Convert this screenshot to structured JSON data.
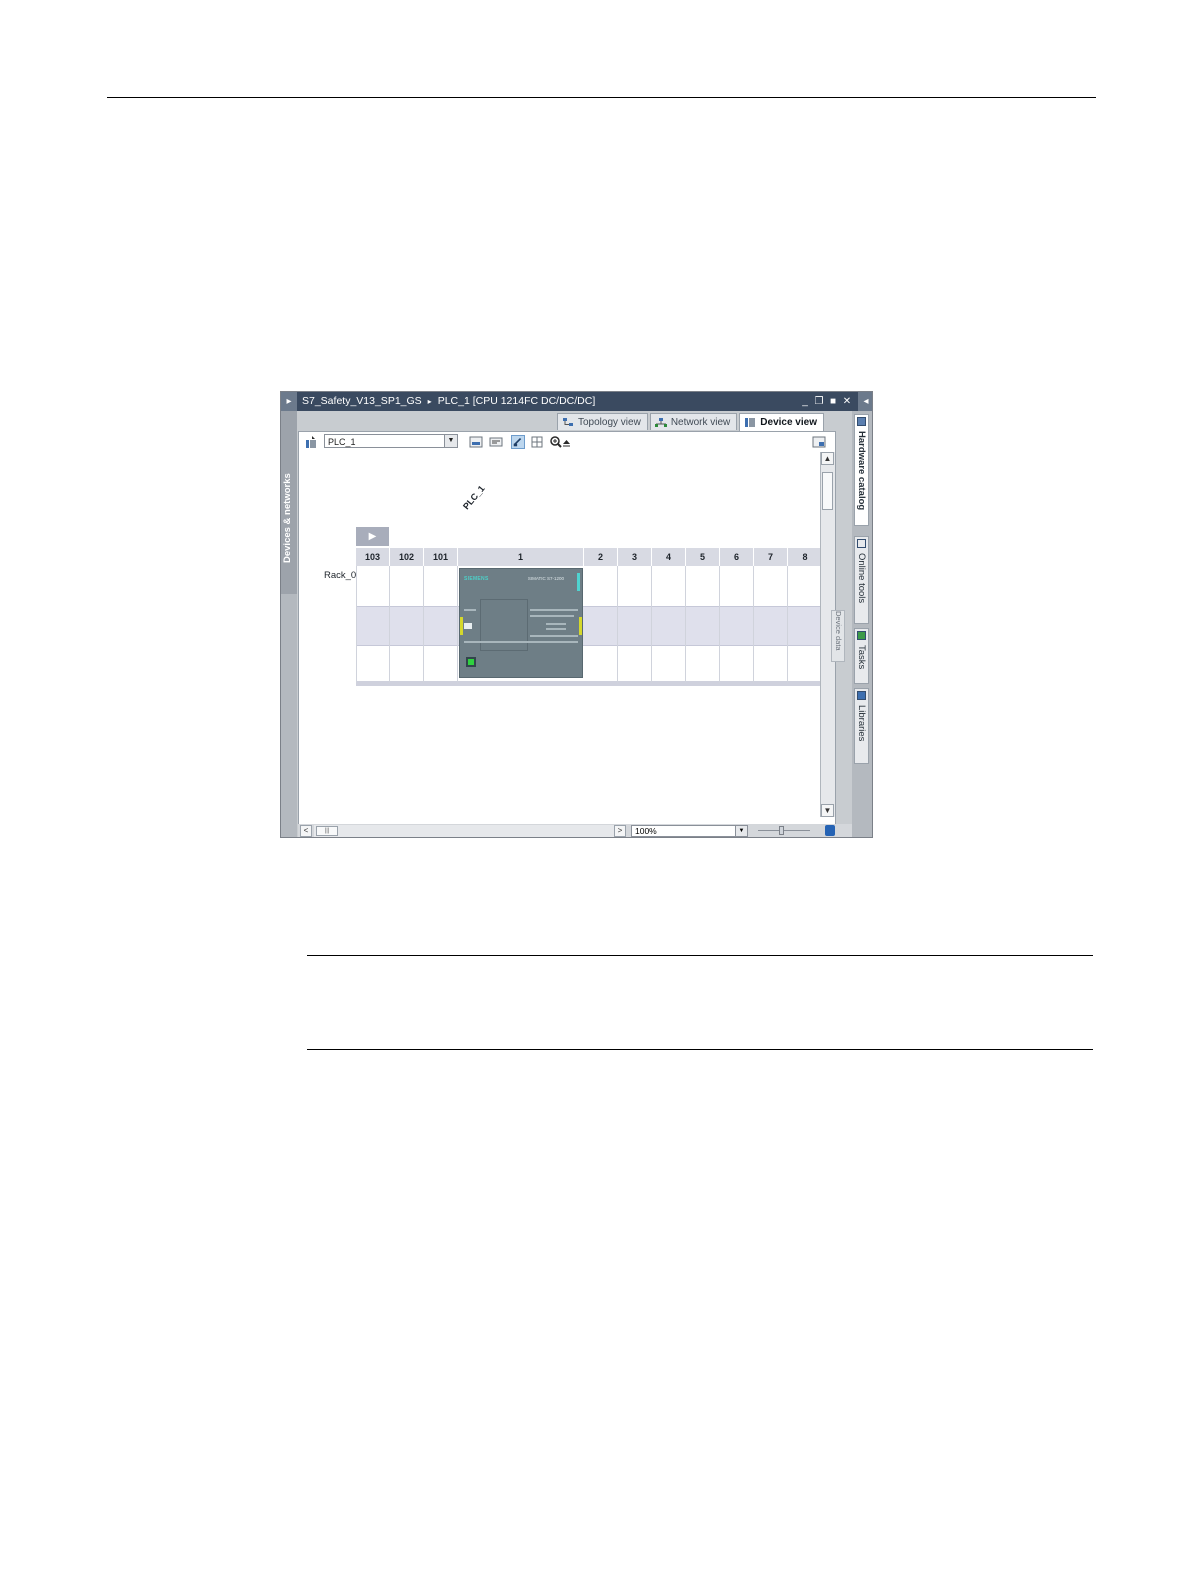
{
  "window": {
    "title_project": "S7_Safety_V13_SP1_GS",
    "title_separator": "▸",
    "title_device": "PLC_1 [CPU 1214FC DC/DC/DC]",
    "minimize": "_",
    "restore": "❐",
    "maximize": "■",
    "close": "✕",
    "collapse_left": "▸",
    "collapse_right": "◂"
  },
  "tabs": [
    {
      "label": "Topology view",
      "icon": "topology-icon",
      "active": false
    },
    {
      "label": "Network view",
      "icon": "network-icon",
      "active": false
    },
    {
      "label": "Device view",
      "icon": "device-icon",
      "active": true
    }
  ],
  "left_panel": {
    "label": "Devices & networks"
  },
  "right_panel": [
    {
      "label": "Hardware catalog"
    },
    {
      "label": "Online tools"
    },
    {
      "label": "Tasks"
    },
    {
      "label": "Libraries"
    }
  ],
  "toolbar": {
    "device_select": "PLC_1",
    "dropdown_arrow": "▼"
  },
  "rack": {
    "name": "Rack_0",
    "expand": "▶",
    "slots": [
      "103",
      "102",
      "101",
      "1",
      "2",
      "3",
      "4",
      "5",
      "6",
      "7",
      "8"
    ]
  },
  "device": {
    "name": "PLC_1",
    "brand": "SIEMENS",
    "model": "SIMATIC S7-1200"
  },
  "device_data_panel": {
    "label": "Device data"
  },
  "scroll": {
    "up": "▲",
    "down": "▼",
    "left": "<",
    "right": ">",
    "grip": "|||"
  },
  "zoom": {
    "value": "100%",
    "arrow": "▼"
  },
  "colors": {
    "titlebar": "#3a4a60",
    "cpu_body": "#6e7e86",
    "cpu_accent": "#4dd0c8",
    "connector": "#d5d82b",
    "port": "#2fd13f"
  }
}
